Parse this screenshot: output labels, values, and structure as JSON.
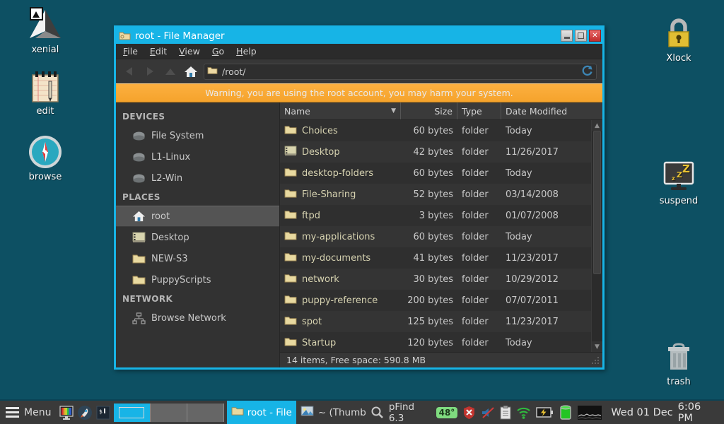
{
  "desktop": {
    "background_color": "#0d5063",
    "icons_left": [
      {
        "label": "xenial",
        "icon": "mountain-peak-icon"
      },
      {
        "label": "edit",
        "icon": "notepad-icon"
      },
      {
        "label": "browse",
        "icon": "compass-icon"
      }
    ],
    "icons_right": [
      {
        "label": "Xlock",
        "icon": "padlock-icon"
      },
      {
        "label": "suspend",
        "icon": "monitor-sleep-icon"
      },
      {
        "label": "trash",
        "icon": "trash-can-icon"
      }
    ]
  },
  "window": {
    "title": "root - File Manager",
    "title_icon": "folder-icon",
    "accent_color": "#17b4e6",
    "buttons": {
      "minimize": "minimize-button",
      "maximize": "maximize-button",
      "close": "close-button"
    },
    "menubar": [
      {
        "label": "File",
        "accel": "F"
      },
      {
        "label": "Edit",
        "accel": "E"
      },
      {
        "label": "View",
        "accel": "V"
      },
      {
        "label": "Go",
        "accel": "G"
      },
      {
        "label": "Help",
        "accel": "H"
      }
    ],
    "toolbar": {
      "back": "back-button",
      "forward": "forward-button",
      "up": "up-button",
      "home": "home-button",
      "path_value": "/root/",
      "path_icon": "folder-icon",
      "reload": "reload-button"
    },
    "warning": "Warning, you are using the root account, you may harm your system.",
    "warning_bg": "#f5a32c"
  },
  "sidebar": {
    "sections": [
      {
        "title": "DEVICES",
        "items": [
          {
            "label": "File System",
            "icon": "drive-icon",
            "selected": false
          },
          {
            "label": "L1-Linux",
            "icon": "drive-icon",
            "selected": false
          },
          {
            "label": "L2-Win",
            "icon": "drive-icon",
            "selected": false
          }
        ]
      },
      {
        "title": "PLACES",
        "items": [
          {
            "label": "root",
            "icon": "home-icon",
            "selected": true
          },
          {
            "label": "Desktop",
            "icon": "desktop-folder-icon",
            "selected": false
          },
          {
            "label": "NEW-S3",
            "icon": "folder-icon",
            "selected": false
          },
          {
            "label": "PuppyScripts",
            "icon": "folder-icon",
            "selected": false
          }
        ]
      },
      {
        "title": "NETWORK",
        "items": [
          {
            "label": "Browse Network",
            "icon": "network-icon",
            "selected": false
          }
        ]
      }
    ]
  },
  "filelist": {
    "columns": [
      "Name",
      "Size",
      "Type",
      "Date Modified"
    ],
    "sort_column": "Name",
    "sort_direction": "descending",
    "rows": [
      {
        "name": "Choices",
        "size": "60 bytes",
        "type": "folder",
        "date": "Today",
        "icon": "folder-icon"
      },
      {
        "name": "Desktop",
        "size": "42 bytes",
        "type": "folder",
        "date": "11/26/2017",
        "icon": "desktop-folder-icon"
      },
      {
        "name": "desktop-folders",
        "size": "60 bytes",
        "type": "folder",
        "date": "Today",
        "icon": "folder-icon"
      },
      {
        "name": "File-Sharing",
        "size": "52 bytes",
        "type": "folder",
        "date": "03/14/2008",
        "icon": "folder-icon"
      },
      {
        "name": "ftpd",
        "size": "3 bytes",
        "type": "folder",
        "date": "01/07/2008",
        "icon": "folder-icon"
      },
      {
        "name": "my-applications",
        "size": "60 bytes",
        "type": "folder",
        "date": "Today",
        "icon": "folder-icon"
      },
      {
        "name": "my-documents",
        "size": "41 bytes",
        "type": "folder",
        "date": "11/23/2017",
        "icon": "folder-icon"
      },
      {
        "name": "network",
        "size": "30 bytes",
        "type": "folder",
        "date": "10/29/2012",
        "icon": "folder-icon"
      },
      {
        "name": "puppy-reference",
        "size": "200 bytes",
        "type": "folder",
        "date": "07/07/2011",
        "icon": "folder-icon"
      },
      {
        "name": "spot",
        "size": "125 bytes",
        "type": "folder",
        "date": "11/23/2017",
        "icon": "folder-icon"
      },
      {
        "name": "Startup",
        "size": "120 bytes",
        "type": "folder",
        "date": "Today",
        "icon": "folder-icon"
      }
    ],
    "status": "14 items, Free space: 590.8 MB"
  },
  "taskbar": {
    "menu_label": "Menu",
    "launchers": [
      {
        "name": "display-settings-icon"
      },
      {
        "name": "rocket-launcher-icon"
      },
      {
        "name": "terminal-icon"
      }
    ],
    "pager": {
      "cells": 3,
      "active_index": 0
    },
    "tasks": [
      {
        "label": "root - File",
        "icon": "folder-icon",
        "active": true
      },
      {
        "label": "~ (Thumb",
        "icon": "image-viewer-icon",
        "active": false
      }
    ],
    "tray": [
      {
        "name": "pfind-icon",
        "label": "pFind 6.3"
      },
      {
        "name": "temperature-badge",
        "label": "48°"
      },
      {
        "name": "firewall-shield-icon",
        "label": ""
      },
      {
        "name": "volume-muted-icon",
        "label": ""
      },
      {
        "name": "clipboard-icon",
        "label": ""
      },
      {
        "name": "wifi-icon",
        "label": ""
      },
      {
        "name": "battery-charging-icon",
        "label": ""
      },
      {
        "name": "memory-gauge-icon",
        "label": ""
      },
      {
        "name": "cpu-graph-icon",
        "label": ""
      }
    ],
    "clock_date": "Wed 01 Dec",
    "clock_time": "6:06 PM"
  }
}
